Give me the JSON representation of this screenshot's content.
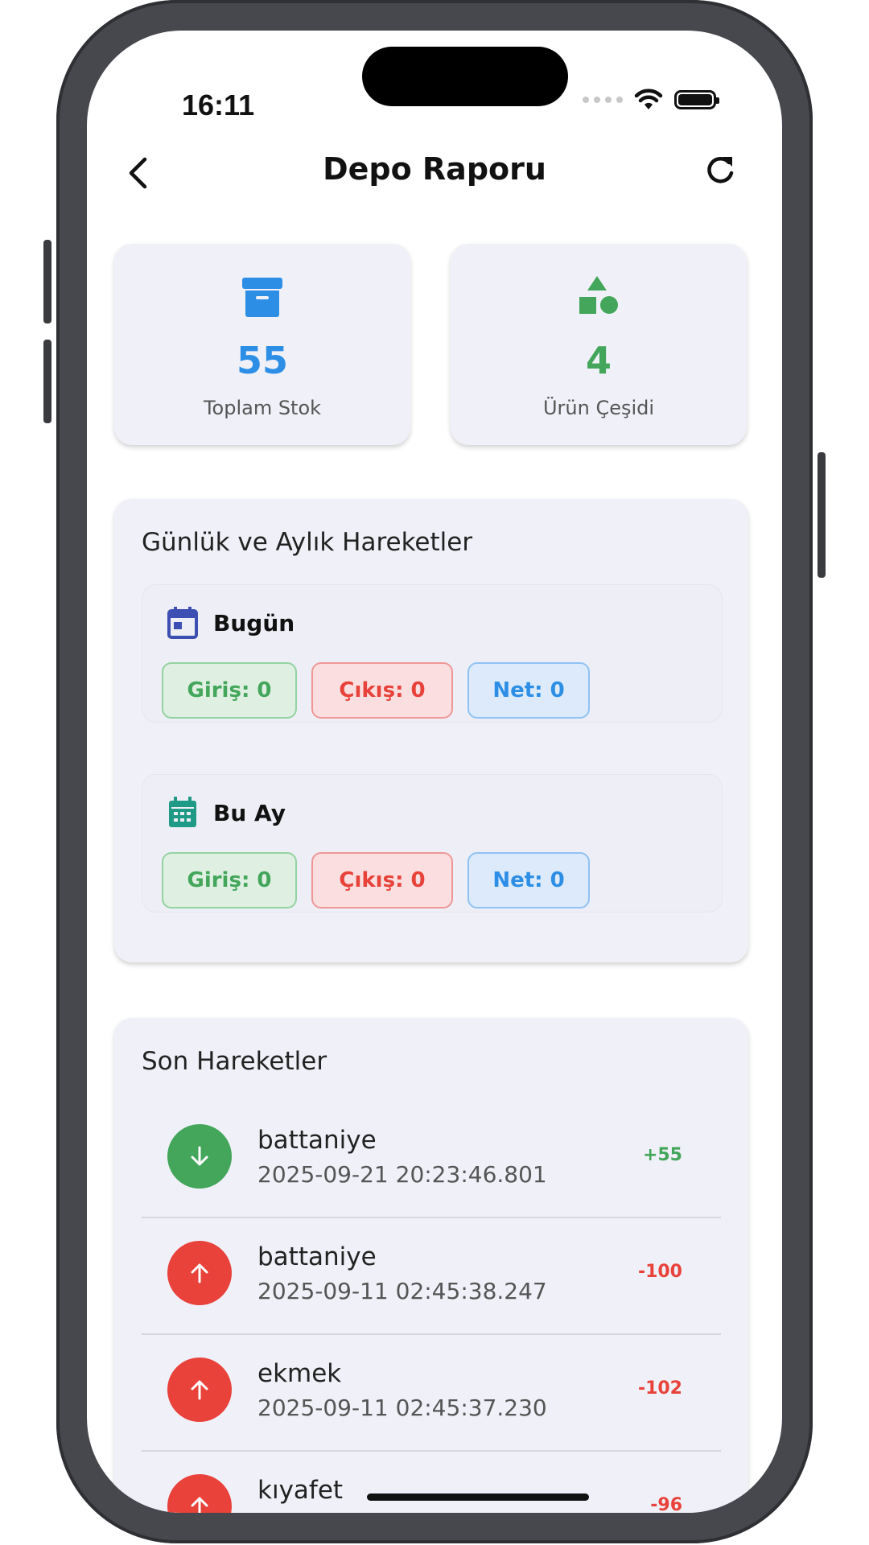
{
  "status_bar": {
    "time": "16:11"
  },
  "header": {
    "title": "Depo Raporu"
  },
  "stats": {
    "total_stock": {
      "value": "55",
      "label": "Toplam Stok",
      "color": "#2d8ee6"
    },
    "product_types": {
      "value": "4",
      "label": "Ürün Çeşidi",
      "color": "#43a65a"
    }
  },
  "movements": {
    "title": "Günlük ve Aylık Hareketler",
    "today": {
      "label": "Bugün",
      "in": "Giriş: 0",
      "out": "Çıkış: 0",
      "net": "Net: 0"
    },
    "month": {
      "label": "Bu Ay",
      "in": "Giriş: 0",
      "out": "Çıkış: 0",
      "net": "Net: 0"
    }
  },
  "recent": {
    "title": "Son Hareketler",
    "items": [
      {
        "name": "battaniye",
        "date": "2025-09-21 20:23:46.801",
        "amount": "+55",
        "direction": "in"
      },
      {
        "name": "battaniye",
        "date": "2025-09-11 02:45:38.247",
        "amount": "-100",
        "direction": "out"
      },
      {
        "name": "ekmek",
        "date": "2025-09-11 02:45:37.230",
        "amount": "-102",
        "direction": "out"
      },
      {
        "name": "kıyafet",
        "date": "",
        "amount": "-96",
        "direction": "out"
      }
    ]
  },
  "colors": {
    "in": "#43a65a",
    "out": "#e8423a",
    "accent_blue": "#2d8ee6"
  },
  "icons": {
    "back": "chevron-left-icon",
    "refresh": "refresh-icon",
    "total_stock": "archive-box-icon",
    "product_types": "shapes-icon",
    "today": "calendar-today-icon",
    "month": "calendar-month-icon",
    "in_row": "arrow-down-icon",
    "out_row": "arrow-up-icon"
  }
}
